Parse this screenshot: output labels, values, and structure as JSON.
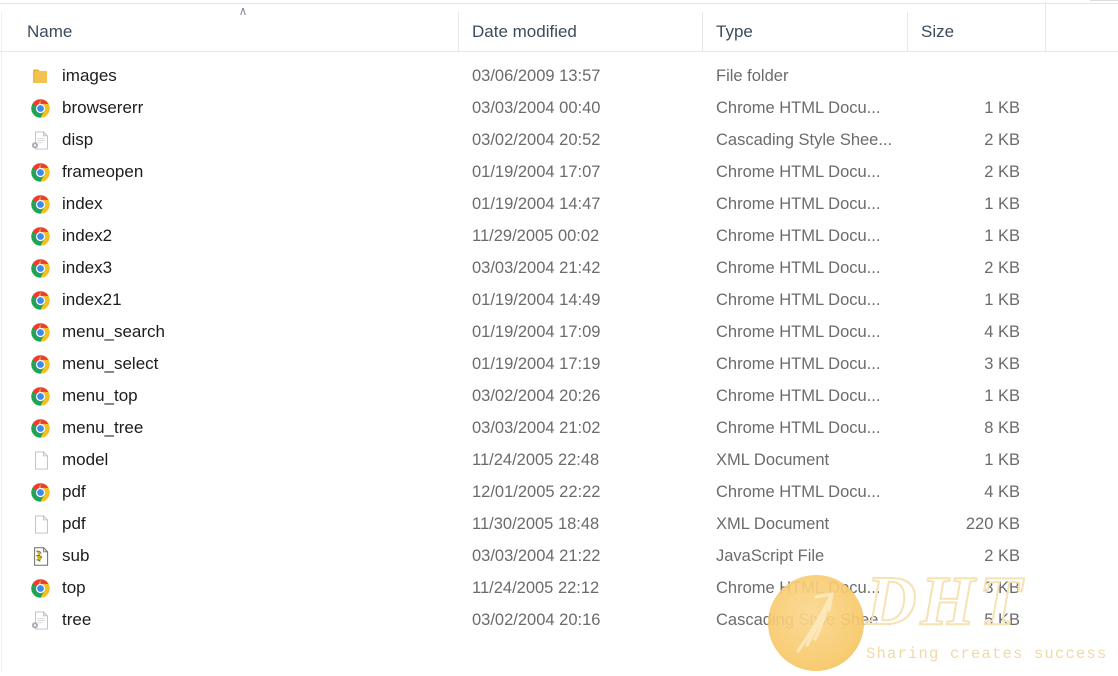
{
  "window": {
    "app": "File Explorer",
    "view": "Details"
  },
  "columns": {
    "sort_indicator": "∧",
    "sort_column": "Name",
    "sort_direction": "ascending",
    "headers": [
      {
        "label": "Name",
        "key": "name"
      },
      {
        "label": "Date modified",
        "key": "date"
      },
      {
        "label": "Type",
        "key": "type"
      },
      {
        "label": "Size",
        "key": "size"
      }
    ]
  },
  "files": [
    {
      "name": "images",
      "date": "03/06/2009 13:57",
      "type": "File folder",
      "size": "",
      "icon": "folder-icon"
    },
    {
      "name": "browsererr",
      "date": "03/03/2004 00:40",
      "type": "Chrome HTML Docu...",
      "size": "1 KB",
      "icon": "chrome-html-icon"
    },
    {
      "name": "disp",
      "date": "03/02/2004 20:52",
      "type": "Cascading Style Shee...",
      "size": "2 KB",
      "icon": "css-file-icon"
    },
    {
      "name": "frameopen",
      "date": "01/19/2004 17:07",
      "type": "Chrome HTML Docu...",
      "size": "2 KB",
      "icon": "chrome-html-icon"
    },
    {
      "name": "index",
      "date": "01/19/2004 14:47",
      "type": "Chrome HTML Docu...",
      "size": "1 KB",
      "icon": "chrome-html-icon"
    },
    {
      "name": "index2",
      "date": "11/29/2005 00:02",
      "type": "Chrome HTML Docu...",
      "size": "1 KB",
      "icon": "chrome-html-icon"
    },
    {
      "name": "index3",
      "date": "03/03/2004 21:42",
      "type": "Chrome HTML Docu...",
      "size": "2 KB",
      "icon": "chrome-html-icon"
    },
    {
      "name": "index21",
      "date": "01/19/2004 14:49",
      "type": "Chrome HTML Docu...",
      "size": "1 KB",
      "icon": "chrome-html-icon"
    },
    {
      "name": "menu_search",
      "date": "01/19/2004 17:09",
      "type": "Chrome HTML Docu...",
      "size": "4 KB",
      "icon": "chrome-html-icon"
    },
    {
      "name": "menu_select",
      "date": "01/19/2004 17:19",
      "type": "Chrome HTML Docu...",
      "size": "3 KB",
      "icon": "chrome-html-icon"
    },
    {
      "name": "menu_top",
      "date": "03/02/2004 20:26",
      "type": "Chrome HTML Docu...",
      "size": "1 KB",
      "icon": "chrome-html-icon"
    },
    {
      "name": "menu_tree",
      "date": "03/03/2004 21:02",
      "type": "Chrome HTML Docu...",
      "size": "8 KB",
      "icon": "chrome-html-icon"
    },
    {
      "name": "model",
      "date": "11/24/2005 22:48",
      "type": "XML Document",
      "size": "1 KB",
      "icon": "xml-file-icon"
    },
    {
      "name": "pdf",
      "date": "12/01/2005 22:22",
      "type": "Chrome HTML Docu...",
      "size": "4 KB",
      "icon": "chrome-html-icon"
    },
    {
      "name": "pdf",
      "date": "11/30/2005 18:48",
      "type": "XML Document",
      "size": "220 KB",
      "icon": "xml-file-icon"
    },
    {
      "name": "sub",
      "date": "03/03/2004 21:22",
      "type": "JavaScript File",
      "size": "2 KB",
      "icon": "javascript-file-icon"
    },
    {
      "name": "top",
      "date": "11/24/2005 22:12",
      "type": "Chrome HTML Docu...",
      "size": "3 KB",
      "icon": "chrome-html-icon"
    },
    {
      "name": "tree",
      "date": "03/02/2004 20:16",
      "type": "Cascading Style Shee...",
      "size": "5 KB",
      "icon": "css-file-icon"
    }
  ],
  "watermark": {
    "logo_text": "DHT",
    "tagline": "Sharing creates success",
    "mark_color": "#f3bf55",
    "text_color": "#f0d9a8"
  },
  "colors": {
    "background": "#ffffff",
    "header_text": "#3c4c5c",
    "name_text": "#1c1c1c",
    "meta_text": "#6b6b6b",
    "divider": "#e8e8e8",
    "folder_icon": "#f2c14e"
  }
}
